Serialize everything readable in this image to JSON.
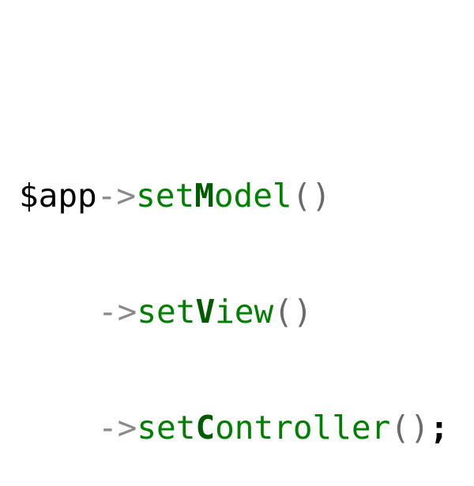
{
  "code": {
    "variable": "$app",
    "arrow": "->",
    "calls": [
      {
        "prefix": "set",
        "initial": "M",
        "rest": "odel",
        "parens": "()"
      },
      {
        "prefix": "set",
        "initial": "V",
        "rest": "iew",
        "parens": "()"
      },
      {
        "prefix": "set",
        "initial": "C",
        "rest": "ontroller",
        "parens": "()"
      }
    ],
    "terminator": ";"
  },
  "colors": {
    "variable": "#000000",
    "arrow": "#8a8a8a",
    "method": "#008000",
    "initial": "#005a00",
    "parens": "#6a6a6a"
  }
}
